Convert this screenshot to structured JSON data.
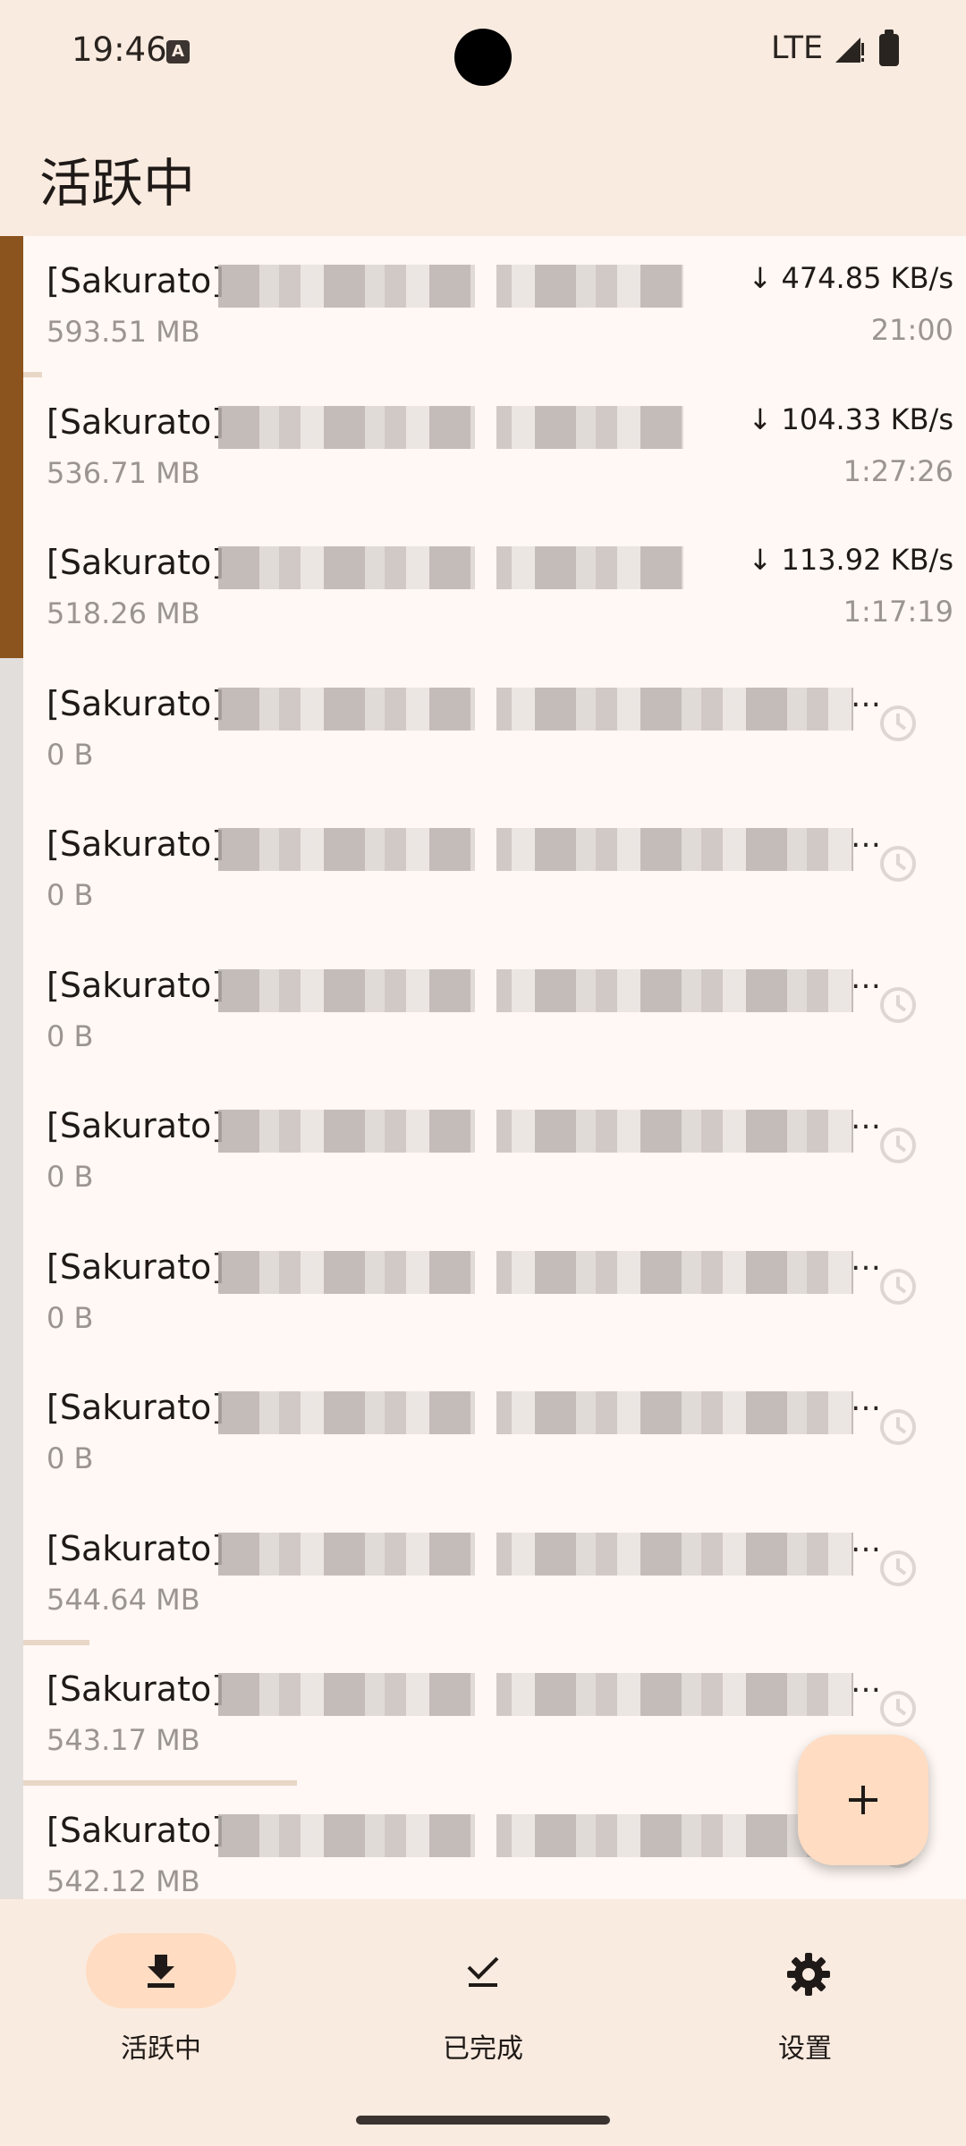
{
  "status_bar": {
    "time": "19:46",
    "network": "LTE",
    "a_icon": "A"
  },
  "title": "活跃中",
  "rows": [
    {
      "name": "[Sakurato]",
      "size": "593.51 MB",
      "speed": "↓ 474.85 KB/s",
      "eta": "21:00",
      "state": "downloading",
      "progress": 0.02
    },
    {
      "name": "[Sakurato]",
      "size": "536.71 MB",
      "speed": "↓ 104.33 KB/s",
      "eta": "1:27:26",
      "state": "downloading",
      "progress": 0.0
    },
    {
      "name": "[Sakurato]",
      "size": "518.26 MB",
      "speed": "↓ 113.92 KB/s",
      "eta": "1:17:19",
      "state": "downloading",
      "progress": 0.0
    },
    {
      "name": "[Sakurato]",
      "size": "0 B",
      "state": "queued",
      "ellipsis": "…"
    },
    {
      "name": "[Sakurato]",
      "size": "0 B",
      "state": "queued",
      "ellipsis": "…"
    },
    {
      "name": "[Sakurato]",
      "size": "0 B",
      "state": "queued",
      "ellipsis": "…"
    },
    {
      "name": "[Sakurato]",
      "size": "0 B",
      "state": "queued",
      "ellipsis": "…"
    },
    {
      "name": "[Sakurato]",
      "size": "0 B",
      "state": "queued",
      "ellipsis": "…"
    },
    {
      "name": "[Sakurato]",
      "size": "0 B",
      "state": "queued",
      "ellipsis": "…"
    },
    {
      "name": "[Sakurato]",
      "size": "544.64 MB",
      "state": "queued",
      "ellipsis": "…",
      "progress": 0.07
    },
    {
      "name": "[Sakurato]",
      "size": "543.17 MB",
      "state": "queued",
      "ellipsis": "…",
      "progress": 0.29
    },
    {
      "name": "[Sakurato]",
      "size": "542.12 MB",
      "state": "queued",
      "ellipsis": ""
    }
  ],
  "fab": {
    "icon": "plus-icon"
  },
  "nav": [
    {
      "label": "活跃中",
      "icon": "download-icon",
      "active": true
    },
    {
      "label": "已完成",
      "icon": "check-icon",
      "active": false
    },
    {
      "label": "设置",
      "icon": "gear-icon",
      "active": false
    }
  ],
  "colors": {
    "accent": "#8b531d",
    "background": "#faebe0",
    "list_bg": "#fff8f4",
    "pill": "#ffdcc2"
  }
}
